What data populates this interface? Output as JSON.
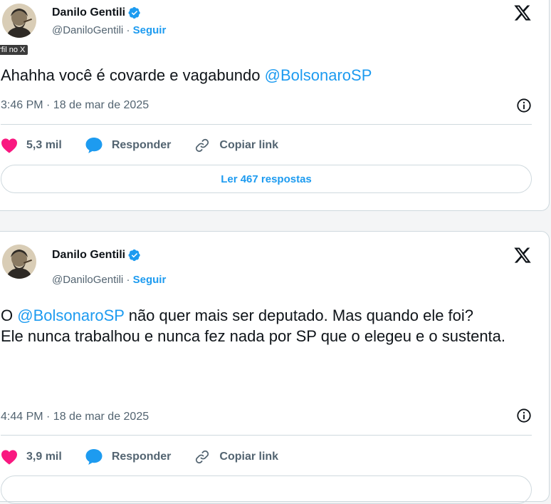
{
  "tweets": [
    {
      "author_name": "Danilo Gentili",
      "handle": "@DaniloGentili",
      "separator": "·",
      "follow_label": "Seguir",
      "text_before": "Ahahha você é covarde e vagabundo ",
      "mention": "@BolsonaroSP",
      "text_after": "",
      "timestamp": "3:46 PM · 18 de mar de 2025",
      "likes": "5,3 mil",
      "reply_label": "Responder",
      "copy_link_label": "Copiar link",
      "read_replies_label": "Ler 467 respostas",
      "tooltip": "er perfil no X"
    },
    {
      "author_name": "Danilo Gentili",
      "handle": "@DaniloGentili",
      "separator": "·",
      "follow_label": "Seguir",
      "text_before": "O ",
      "mention": "@BolsonaroSP",
      "text_after": " não quer mais ser deputado. Mas quando ele foi?\nEle nunca trabalhou e nunca fez nada por SP que o elegeu e o sustenta.",
      "timestamp": "4:44 PM · 18 de mar de 2025",
      "likes": "3,9 mil",
      "reply_label": "Responder",
      "copy_link_label": "Copiar link"
    }
  ],
  "icons": {
    "verified": "verified-badge-icon",
    "x_logo": "x-logo-icon",
    "info": "info-icon",
    "like": "heart-icon",
    "reply": "speech-bubble-icon",
    "copy_link": "link-icon"
  },
  "colors": {
    "accent": "#1d9bf0",
    "like": "#f91880",
    "text": "#0f1419",
    "muted": "#536471",
    "border": "#cfd9de"
  }
}
